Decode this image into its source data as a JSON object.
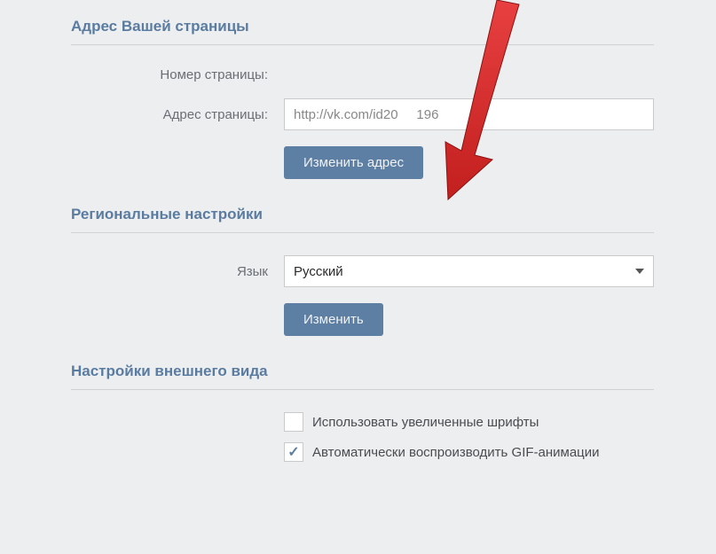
{
  "address": {
    "title": "Адрес Вашей страницы",
    "number_label": "Номер страницы:",
    "url_label": "Адрес страницы:",
    "url_value": "http://vk.com/id20     196",
    "change_button": "Изменить адрес"
  },
  "regional": {
    "title": "Региональные настройки",
    "language_label": "Язык",
    "language_value": "Русский",
    "change_button": "Изменить"
  },
  "appearance": {
    "title": "Настройки внешнего вида",
    "large_fonts_label": "Использовать увеличенные шрифты",
    "gif_autoplay_label": "Автоматически воспроизводить GIF-анимации"
  }
}
